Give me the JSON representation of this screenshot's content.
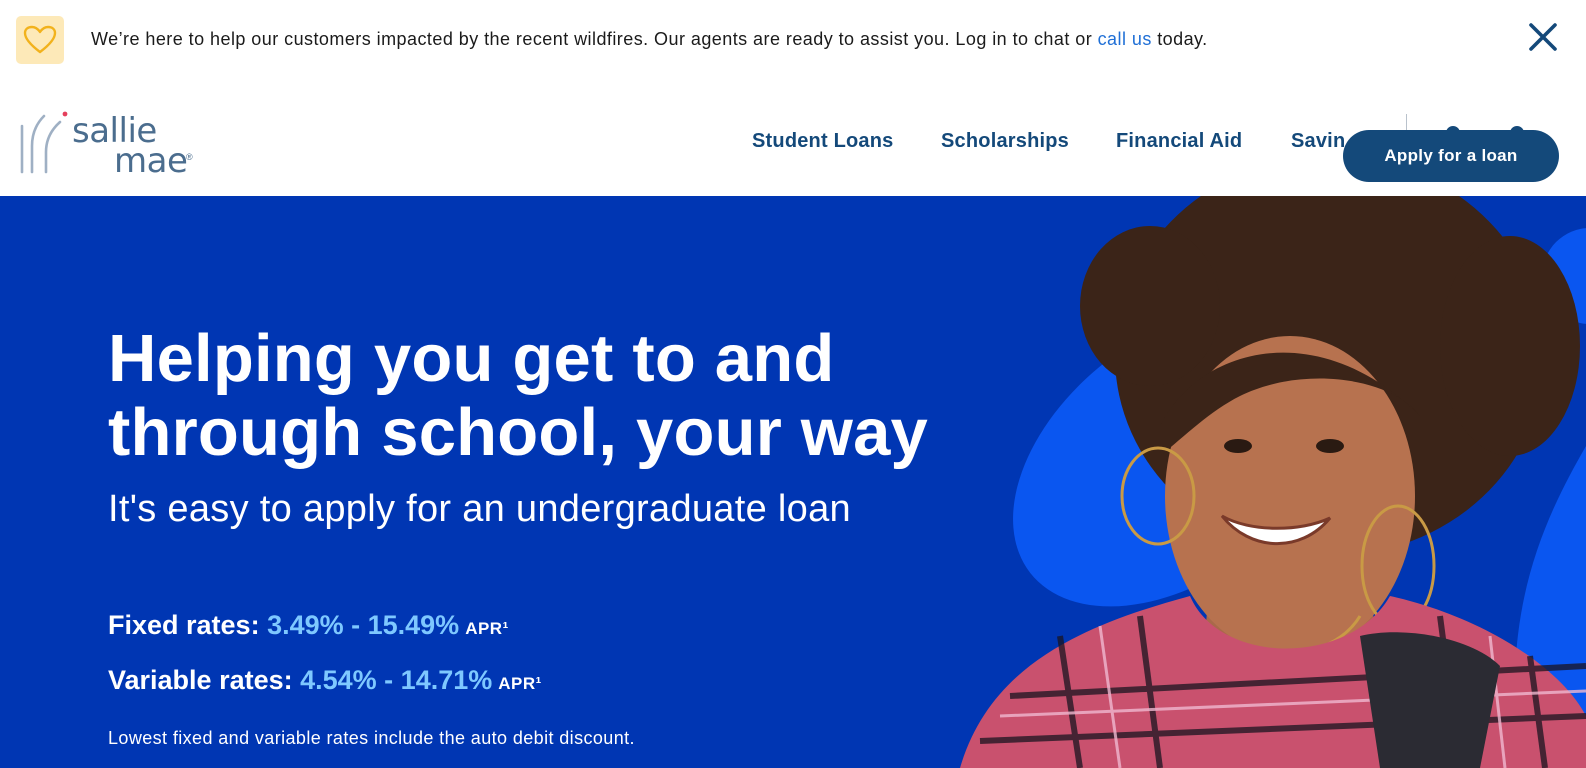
{
  "alert": {
    "icon": "heart-icon",
    "text_before": "We’re here to help our customers impacted by the recent wildfires. Our agents are ready to assist you. Log in to chat or ",
    "link_text": "call us",
    "text_after": " today.",
    "close_icon": "close-icon"
  },
  "header": {
    "logo": {
      "line1": "sallie",
      "line2": "mae",
      "mark": "®"
    },
    "nav": [
      {
        "label": "Student Loans"
      },
      {
        "label": "Scholarships"
      },
      {
        "label": "Financial Aid"
      },
      {
        "label": "Savin"
      }
    ],
    "apply_label": "Apply for a loan"
  },
  "hero": {
    "title_line1": "Helping you get to and",
    "title_line2": "through school, your way",
    "subtitle": "It's easy to apply for an undergraduate loan",
    "fixed": {
      "label": "Fixed rates: ",
      "value": "3.49% - 15.49%",
      "apr": "APR¹"
    },
    "variable": {
      "label": "Variable rates: ",
      "value": "4.54% - 14.71%",
      "apr": "APR¹"
    },
    "disclaimer": "Lowest fixed and variable rates include the auto debit discount."
  },
  "colors": {
    "brand_navy": "#14497a",
    "hero_blue": "#0036b3",
    "rate_accent": "#7ec8ff",
    "link_blue": "#1f6fd6",
    "alert_icon_bg": "#fde9b8"
  }
}
